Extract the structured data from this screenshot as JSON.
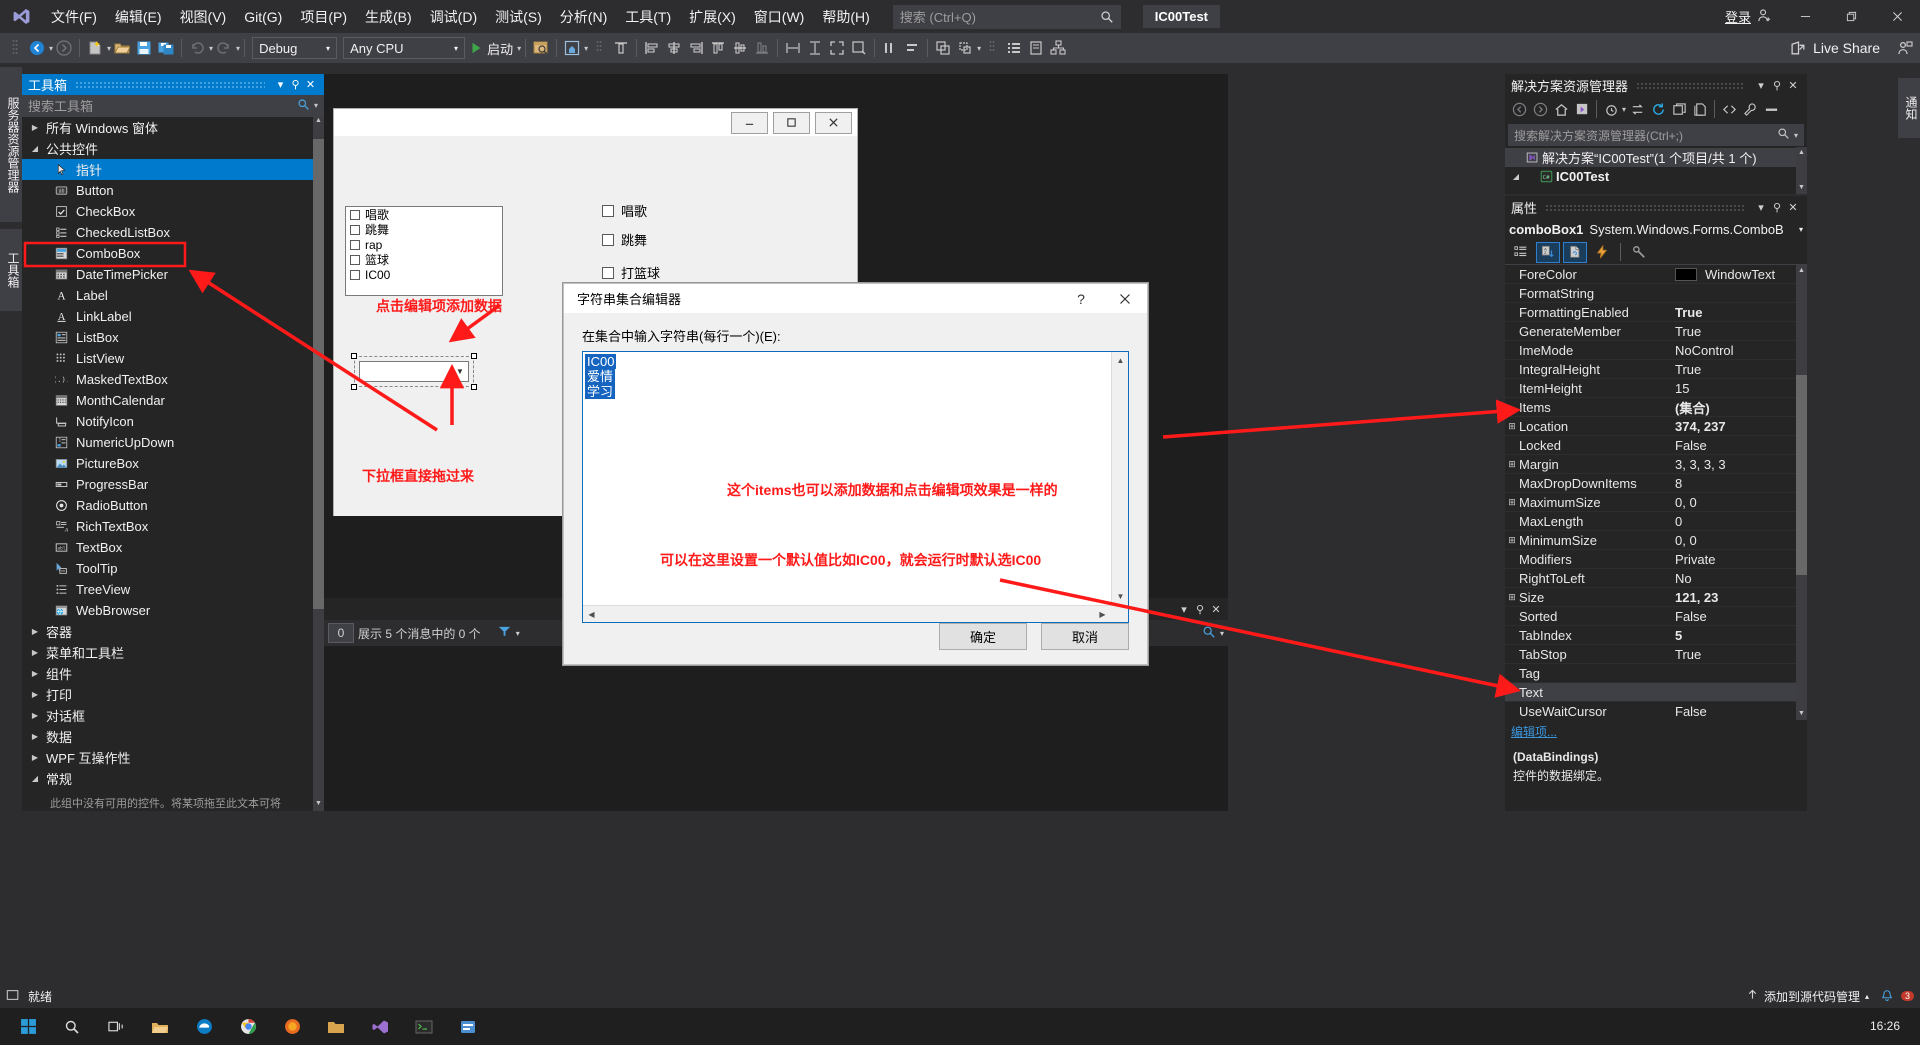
{
  "app": {
    "project_chip": "IC00Test",
    "signin_label": "登录"
  },
  "menu": {
    "items": [
      {
        "label": "文件(F)"
      },
      {
        "label": "编辑(E)"
      },
      {
        "label": "视图(V)"
      },
      {
        "label": "Git(G)"
      },
      {
        "label": "项目(P)"
      },
      {
        "label": "生成(B)"
      },
      {
        "label": "调试(D)"
      },
      {
        "label": "测试(S)"
      },
      {
        "label": "分析(N)"
      },
      {
        "label": "工具(T)"
      },
      {
        "label": "扩展(X)"
      },
      {
        "label": "窗口(W)"
      },
      {
        "label": "帮助(H)"
      }
    ],
    "search_placeholder": "搜索 (Ctrl+Q)"
  },
  "toolbar": {
    "configuration": "Debug",
    "platform": "Any CPU",
    "run_label": "启动",
    "live_share": "Live Share"
  },
  "left_tabs": [
    {
      "label": "服务器资源管理器"
    },
    {
      "label": "工具箱"
    }
  ],
  "right_tabs": [
    {
      "label": "通知"
    }
  ],
  "toolbox": {
    "title": "工具箱",
    "search_placeholder": "搜索工具箱",
    "groups": [
      {
        "label": "所有 Windows 窗体",
        "expanded": false
      },
      {
        "label": "公共控件",
        "expanded": true
      }
    ],
    "controls": [
      {
        "label": "指针",
        "icon": "pointer-icon",
        "selected": true
      },
      {
        "label": "Button",
        "icon": "button-icon"
      },
      {
        "label": "CheckBox",
        "icon": "checkbox-icon"
      },
      {
        "label": "CheckedListBox",
        "icon": "checkedlistbox-icon"
      },
      {
        "label": "ComboBox",
        "icon": "combobox-icon",
        "highlight": true
      },
      {
        "label": "DateTimePicker",
        "icon": "datetimepicker-icon"
      },
      {
        "label": "Label",
        "icon": "label-icon"
      },
      {
        "label": "LinkLabel",
        "icon": "linklabel-icon"
      },
      {
        "label": "ListBox",
        "icon": "listbox-icon"
      },
      {
        "label": "ListView",
        "icon": "listview-icon"
      },
      {
        "label": "MaskedTextBox",
        "icon": "maskedtextbox-icon"
      },
      {
        "label": "MonthCalendar",
        "icon": "monthcalendar-icon"
      },
      {
        "label": "NotifyIcon",
        "icon": "notifyicon-icon"
      },
      {
        "label": "NumericUpDown",
        "icon": "numericupdown-icon"
      },
      {
        "label": "PictureBox",
        "icon": "picturebox-icon"
      },
      {
        "label": "ProgressBar",
        "icon": "progressbar-icon"
      },
      {
        "label": "RadioButton",
        "icon": "radiobutton-icon"
      },
      {
        "label": "RichTextBox",
        "icon": "richtextbox-icon"
      },
      {
        "label": "TextBox",
        "icon": "textbox-icon"
      },
      {
        "label": "ToolTip",
        "icon": "tooltip-icon"
      },
      {
        "label": "TreeView",
        "icon": "treeview-icon"
      },
      {
        "label": "WebBrowser",
        "icon": "webbrowser-icon"
      }
    ],
    "categories": [
      {
        "label": "容器"
      },
      {
        "label": "菜单和工具栏"
      },
      {
        "label": "组件"
      },
      {
        "label": "打印"
      },
      {
        "label": "对话框"
      },
      {
        "label": "数据"
      },
      {
        "label": "WPF 互操作性"
      },
      {
        "label": "常规"
      }
    ],
    "footer": "此组中没有可用的控件。将某项拖至此文本可将"
  },
  "designer": {
    "checked_listbox_items": [
      "唱歌",
      "跳舞",
      "rap",
      "篮球",
      "IC00"
    ],
    "checkboxes": [
      "唱歌",
      "跳舞",
      "打篮球"
    ],
    "annotations": [
      {
        "text": "点击编辑项添加数据"
      },
      {
        "text": "下拉框直接拖过来"
      },
      {
        "text": "这个items也可以添加数据和点击编辑项效果是一样的"
      },
      {
        "text": "可以在这里设置一个默认值比如IC00，就会运行时默认选IC00"
      }
    ]
  },
  "error_list": {
    "count": "0",
    "message": "展示 5 个消息中的 0 个"
  },
  "solution_explorer": {
    "title": "解决方案资源管理器",
    "search_placeholder": "搜索解决方案资源管理器(Ctrl+;)",
    "tree": [
      {
        "label": "解决方案“IC00Test”(1 个项目/共 1 个)",
        "icon": "solution-icon",
        "selected": true,
        "indent": 0
      },
      {
        "label": "IC00Test",
        "icon": "csharp-project-icon",
        "selected": false,
        "indent": 1
      }
    ]
  },
  "properties": {
    "title": "属性",
    "object_name": "comboBox1",
    "object_type": "System.Windows.Forms.ComboB",
    "rows": [
      {
        "name": "ForeColor",
        "value": "WindowText",
        "expandable": false,
        "swatch": "#000000"
      },
      {
        "name": "FormatString",
        "value": "",
        "expandable": false
      },
      {
        "name": "FormattingEnabled",
        "value": "True",
        "expandable": false,
        "bold": true
      },
      {
        "name": "GenerateMember",
        "value": "True",
        "expandable": false
      },
      {
        "name": "ImeMode",
        "value": "NoControl",
        "expandable": false
      },
      {
        "name": "IntegralHeight",
        "value": "True",
        "expandable": false
      },
      {
        "name": "ItemHeight",
        "value": "15",
        "expandable": false
      },
      {
        "name": "Items",
        "value": "(集合)",
        "expandable": false,
        "bold": true
      },
      {
        "name": "Location",
        "value": "374, 237",
        "expandable": true,
        "bold": true
      },
      {
        "name": "Locked",
        "value": "False",
        "expandable": false
      },
      {
        "name": "Margin",
        "value": "3, 3, 3, 3",
        "expandable": true
      },
      {
        "name": "MaxDropDownItems",
        "value": "8",
        "expandable": false
      },
      {
        "name": "MaximumSize",
        "value": "0, 0",
        "expandable": true
      },
      {
        "name": "MaxLength",
        "value": "0",
        "expandable": false
      },
      {
        "name": "MinimumSize",
        "value": "0, 0",
        "expandable": true
      },
      {
        "name": "Modifiers",
        "value": "Private",
        "expandable": false
      },
      {
        "name": "RightToLeft",
        "value": "No",
        "expandable": false
      },
      {
        "name": "Size",
        "value": "121, 23",
        "expandable": true,
        "bold": true
      },
      {
        "name": "Sorted",
        "value": "False",
        "expandable": false
      },
      {
        "name": "TabIndex",
        "value": "5",
        "expandable": false,
        "bold": true
      },
      {
        "name": "TabStop",
        "value": "True",
        "expandable": false
      },
      {
        "name": "Tag",
        "value": "",
        "expandable": false
      },
      {
        "name": "Text",
        "value": "",
        "expandable": false,
        "selected": true
      },
      {
        "name": "UseWaitCursor",
        "value": "False",
        "expandable": false
      }
    ],
    "edit_items_link": "编辑项...",
    "desc_title": "(DataBindings)",
    "desc_text": "控件的数据绑定。"
  },
  "dialog": {
    "title": "字符串集合编辑器",
    "help_icon": "?",
    "close_icon": "✕",
    "label": "在集合中输入字符串(每行一个)(E):",
    "items": [
      "IC00",
      "爱情",
      "学习"
    ],
    "ok_label": "确定",
    "cancel_label": "取消"
  },
  "status_bar": {
    "text": "就绪",
    "source_control": "添加到源代码管理",
    "notification_count": "3"
  },
  "taskbar": {
    "time": "16:26",
    "date": ""
  },
  "colors": {
    "accent": "#007acc",
    "annotation_red": "#ff1a1a",
    "panel_bg": "#252526",
    "chrome_bg": "#2d2d30",
    "toolbar_bg": "#3f3f46"
  }
}
